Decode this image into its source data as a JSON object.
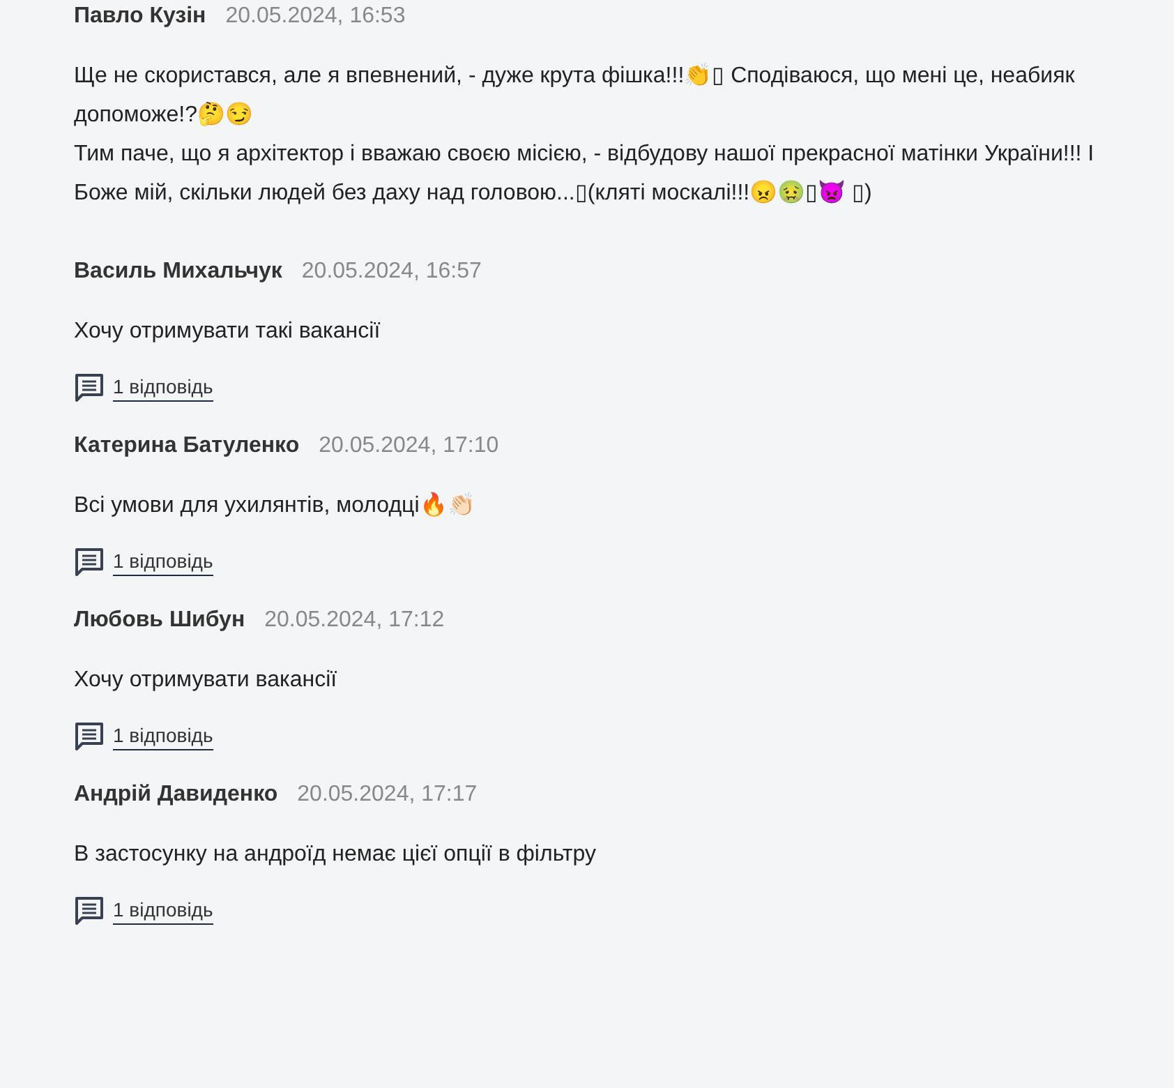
{
  "comments": [
    {
      "author": "Павло Кузін",
      "date": "20.05.2024, 16:53",
      "lines": [
        "Ще не скористався, але я впевнений, - дуже крута фішка!!!👏▯ Сподіваюся, що мені це, неабияк допоможе!?🤔😏",
        "Тим паче, що я архітектор і вважаю своєю місією, - відбудову нашої прекрасної матінки України!!! І Боже мій, скільки людей без даху над головою...▯(кляті москалі!!!😠🤢▯👿 ▯)"
      ]
    },
    {
      "author": "Василь Михальчук",
      "date": "20.05.2024, 16:57",
      "lines": [
        "Хочу отримувати такі вакансії"
      ],
      "replies": "1 відповідь"
    },
    {
      "author": "Катерина Батуленко",
      "date": "20.05.2024, 17:10",
      "lines": [
        "Всі умови для ухилянтів, молодці🔥👏🏻"
      ],
      "replies": "1 відповідь"
    },
    {
      "author": "Любовь Шибун",
      "date": "20.05.2024, 17:12",
      "lines": [
        "Хочу отримувати вакансії"
      ],
      "replies": "1 відповідь"
    },
    {
      "author": "Андрій Давиденко",
      "date": "20.05.2024, 17:17",
      "lines": [
        "В застосунку на андроїд немає цієї опції в фільтру"
      ],
      "replies": "1 відповідь"
    }
  ]
}
